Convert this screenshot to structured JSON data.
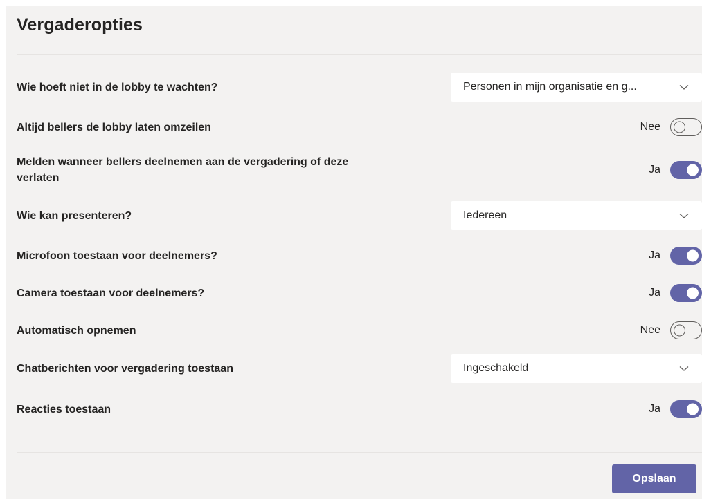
{
  "page": {
    "title": "Vergaderopties",
    "accent_color": "#6264a7"
  },
  "options": {
    "lobby_bypass": {
      "label": "Wie hoeft niet in de lobby te wachten?",
      "value": "Personen in mijn organisatie en g..."
    },
    "callers_bypass": {
      "label": "Altijd bellers de lobby laten omzeilen",
      "state": "Nee",
      "on": false
    },
    "announce_callers": {
      "label": "Melden wanneer bellers deelnemen aan de vergadering of deze verlaten",
      "state": "Ja",
      "on": true
    },
    "who_presents": {
      "label": "Wie kan presenteren?",
      "value": "Iedereen"
    },
    "allow_mic": {
      "label": "Microfoon toestaan voor deelnemers?",
      "state": "Ja",
      "on": true
    },
    "allow_camera": {
      "label": "Camera toestaan voor deelnemers?",
      "state": "Ja",
      "on": true
    },
    "auto_record": {
      "label": "Automatisch opnemen",
      "state": "Nee",
      "on": false
    },
    "chat": {
      "label": "Chatberichten voor vergadering toestaan",
      "value": "Ingeschakeld"
    },
    "reactions": {
      "label": "Reacties toestaan",
      "state": "Ja",
      "on": true
    }
  },
  "footer": {
    "save_label": "Opslaan"
  },
  "icons": {
    "dropdown": "chevron-down-icon"
  }
}
